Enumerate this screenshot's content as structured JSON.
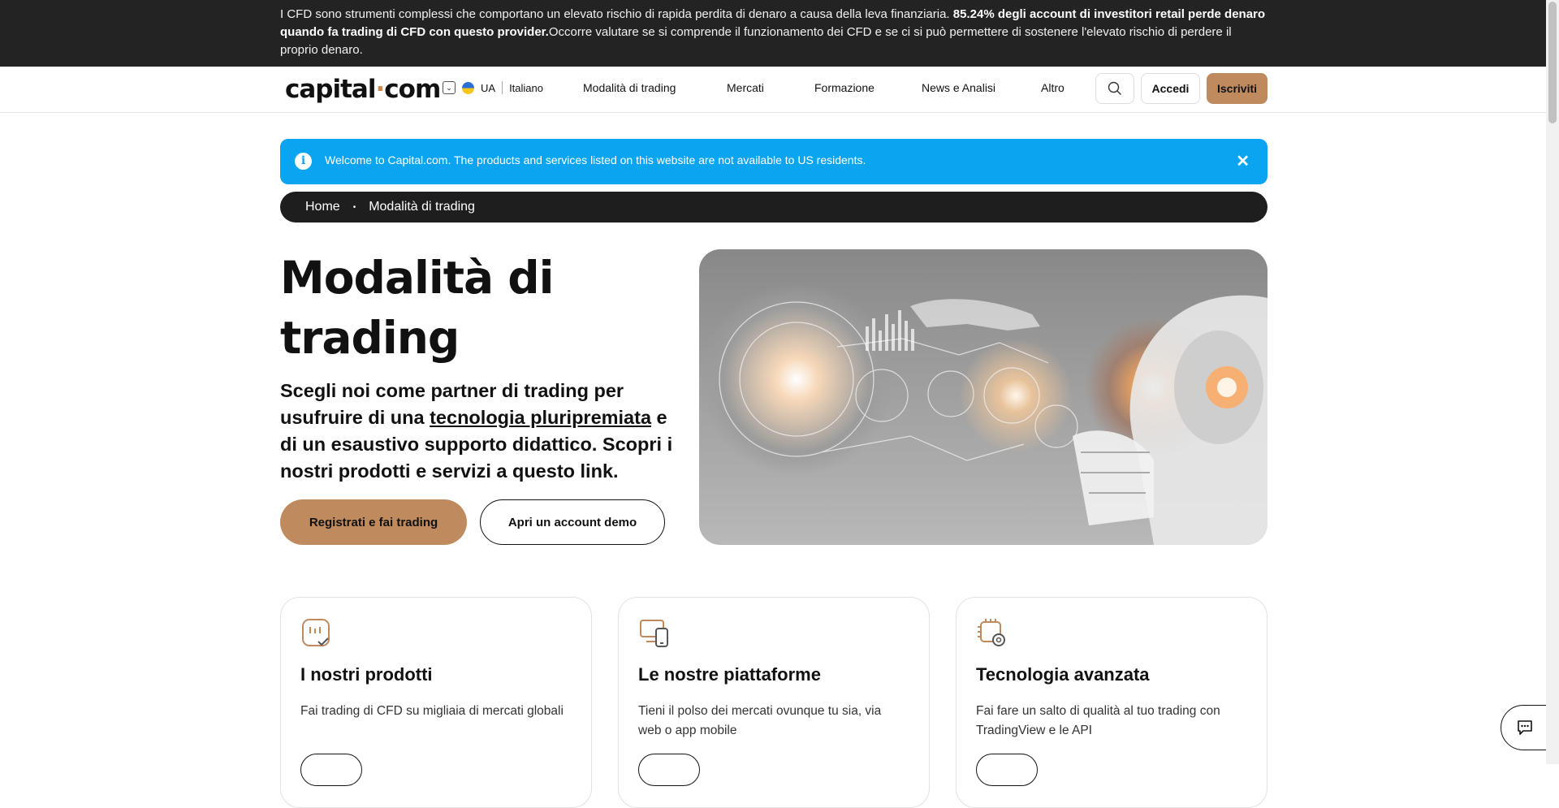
{
  "risk_warning": {
    "part1": "I CFD sono strumenti complessi che comportano un elevato rischio di rapida perdita di denaro a causa della leva finanziaria. ",
    "bold": "85.24% degli account di investitori retail perde denaro quando fa trading di CFD con questo provider.",
    "part2": "Occorre valutare se si comprende il funzionamento dei CFD e se ci si può permettere di sostenere l'elevato rischio di perdere il proprio denaro."
  },
  "header": {
    "logo_left": "capital",
    "logo_dot": "·",
    "logo_right": "com",
    "region": "UA",
    "language": "Italiano",
    "nav": [
      "Modalità di trading",
      "Mercati",
      "Formazione",
      "News e Analisi",
      "Altro"
    ],
    "login": "Accedi",
    "signup": "Iscriviti"
  },
  "notice": {
    "info_glyph": "i",
    "message": "Welcome to Capital.com. The products and services listed on this website are not available to US residents.",
    "close_glyph": "✕"
  },
  "breadcrumb": {
    "home": "Home",
    "separator": "•",
    "current": "Modalità di trading"
  },
  "hero": {
    "title": "Modalità di trading",
    "sub_before": "Scegli noi come partner di trading per usufruire di una ",
    "sub_link": "tecnologia pluripremiata",
    "sub_after": " e di un esaustivo supporto didattico. Scopri i nostri prodotti e servizi a questo link.",
    "cta_primary": "Registrati e fai trading",
    "cta_secondary": "Apri un account demo"
  },
  "cards": [
    {
      "icon": "products-icon",
      "title": "I nostri prodotti",
      "desc": "Fai trading di CFD su migliaia di mercati globali"
    },
    {
      "icon": "devices-icon",
      "title": "Le nostre piattaforme",
      "desc": "Tieni il polso dei mercati ovunque tu sia, via web o app mobile"
    },
    {
      "icon": "chip-gear-icon",
      "title": "Tecnologia avanzata",
      "desc": "Fai fare un salto di qualità al tuo trading con TradingView e le API"
    }
  ],
  "colors": {
    "accent": "#bf8a5e",
    "notice_blue": "#0ba4f0",
    "dark": "#232323"
  }
}
